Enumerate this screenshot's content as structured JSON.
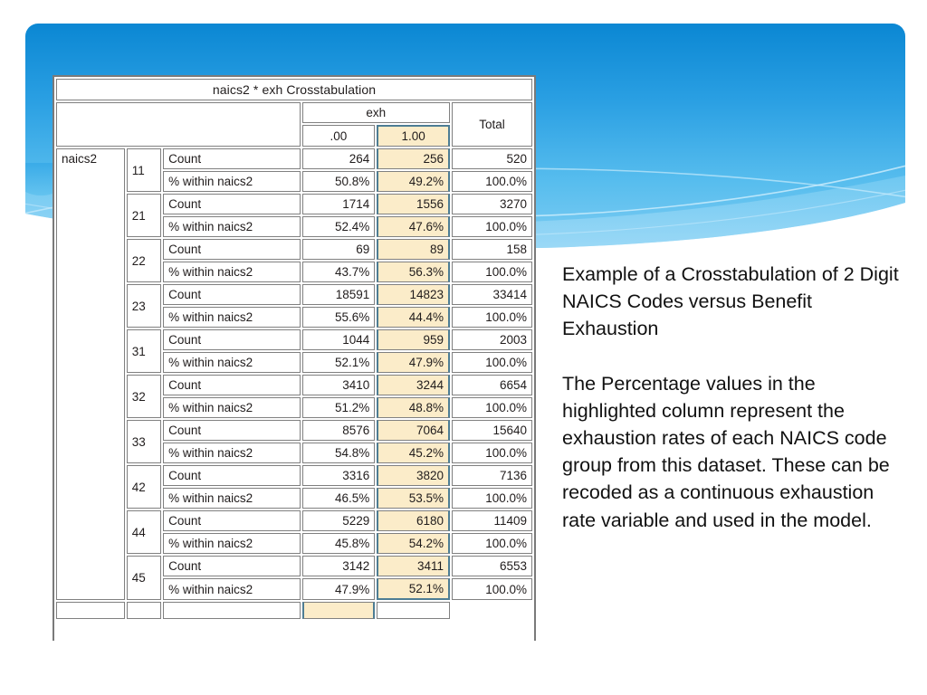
{
  "slide": {
    "background_color": "#ffffff",
    "banner": {
      "name": "blue-decorative-banner",
      "color_top": "#0f8bd6",
      "color_mid": "#41aeea",
      "color_bottom": "#9ad7f5",
      "swoosh_color": "#bfe6fa"
    }
  },
  "table": {
    "title": "naics2 * exh Crosstabulation",
    "column_group_header": "exh",
    "column_headers": [
      ".00",
      "1.00",
      "Total"
    ],
    "row_variable_label": "naics2",
    "measure_labels": [
      "Count",
      "% within naics2"
    ],
    "highlighted_column": "1.00",
    "highlight_color": "#fbecc9",
    "highlight_border_color": "#4d7d94",
    "groups": [
      {
        "code": "11",
        "count": {
          "c00": "264",
          "c100": "256",
          "total": "520"
        },
        "percent": {
          "c00": "50.8%",
          "c100": "49.2%",
          "total": "100.0%"
        }
      },
      {
        "code": "21",
        "count": {
          "c00": "1714",
          "c100": "1556",
          "total": "3270"
        },
        "percent": {
          "c00": "52.4%",
          "c100": "47.6%",
          "total": "100.0%"
        }
      },
      {
        "code": "22",
        "count": {
          "c00": "69",
          "c100": "89",
          "total": "158"
        },
        "percent": {
          "c00": "43.7%",
          "c100": "56.3%",
          "total": "100.0%"
        }
      },
      {
        "code": "23",
        "count": {
          "c00": "18591",
          "c100": "14823",
          "total": "33414"
        },
        "percent": {
          "c00": "55.6%",
          "c100": "44.4%",
          "total": "100.0%"
        }
      },
      {
        "code": "31",
        "count": {
          "c00": "1044",
          "c100": "959",
          "total": "2003"
        },
        "percent": {
          "c00": "52.1%",
          "c100": "47.9%",
          "total": "100.0%"
        }
      },
      {
        "code": "32",
        "count": {
          "c00": "3410",
          "c100": "3244",
          "total": "6654"
        },
        "percent": {
          "c00": "51.2%",
          "c100": "48.8%",
          "total": "100.0%"
        }
      },
      {
        "code": "33",
        "count": {
          "c00": "8576",
          "c100": "7064",
          "total": "15640"
        },
        "percent": {
          "c00": "54.8%",
          "c100": "45.2%",
          "total": "100.0%"
        }
      },
      {
        "code": "42",
        "count": {
          "c00": "3316",
          "c100": "3820",
          "total": "7136"
        },
        "percent": {
          "c00": "46.5%",
          "c100": "53.5%",
          "total": "100.0%"
        }
      },
      {
        "code": "44",
        "count": {
          "c00": "5229",
          "c100": "6180",
          "total": "11409"
        },
        "percent": {
          "c00": "45.8%",
          "c100": "54.2%",
          "total": "100.0%"
        }
      },
      {
        "code": "45",
        "count": {
          "c00": "3142",
          "c100": "3411",
          "total": "6553"
        },
        "percent": {
          "c00": "47.9%",
          "c100": "52.1%",
          "total": "100.0%"
        }
      }
    ]
  },
  "caption": {
    "paragraph1": "Example of a Crosstabulation of 2 Digit NAICS Codes versus Benefit Exhaustion",
    "paragraph2": "The Percentage values in the highlighted column represent the exhaustion rates of each NAICS code group from this dataset. These can be recoded as a continuous exhaustion rate variable and used in the model."
  },
  "chart_data": {
    "type": "table",
    "title": "naics2 * exh Crosstabulation",
    "categories": [
      "11",
      "21",
      "22",
      "23",
      "31",
      "32",
      "33",
      "42",
      "44",
      "45"
    ],
    "xlabel": "naics2 (2 digit NAICS code)",
    "ylabel": "exh (benefit exhaustion)",
    "series": [
      {
        "name": "Count exh = .00",
        "values": [
          264,
          1714,
          69,
          18591,
          1044,
          3410,
          8576,
          3316,
          5229,
          3142
        ]
      },
      {
        "name": "Count exh = 1.00",
        "values": [
          256,
          1556,
          89,
          14823,
          959,
          3244,
          7064,
          3820,
          6180,
          3411
        ]
      },
      {
        "name": "Total",
        "values": [
          520,
          3270,
          158,
          33414,
          2003,
          6654,
          15640,
          7136,
          11409,
          6553
        ]
      },
      {
        "name": "% within naics2, exh = .00",
        "values": [
          50.8,
          52.4,
          43.7,
          55.6,
          52.1,
          51.2,
          54.8,
          46.5,
          45.8,
          47.9
        ]
      },
      {
        "name": "% within naics2, exh = 1.00",
        "values": [
          49.2,
          47.6,
          56.3,
          44.4,
          47.9,
          48.8,
          45.2,
          53.5,
          54.2,
          52.1
        ]
      },
      {
        "name": "% within naics2, Total",
        "values": [
          100.0,
          100.0,
          100.0,
          100.0,
          100.0,
          100.0,
          100.0,
          100.0,
          100.0,
          100.0
        ]
      }
    ],
    "grid": false,
    "legend": "none"
  }
}
